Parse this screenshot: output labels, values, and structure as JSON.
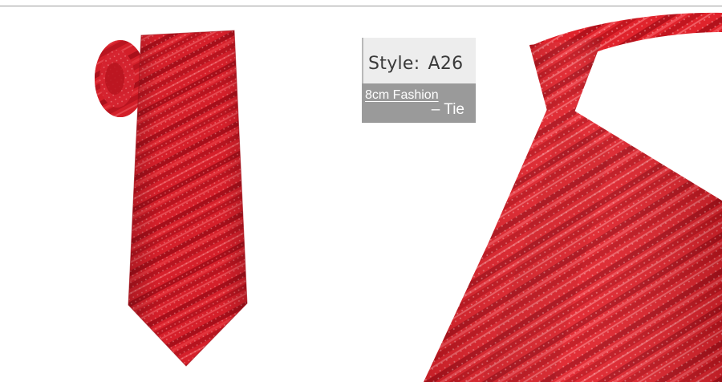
{
  "label": {
    "style_key": "Style:",
    "style_value": "A26",
    "desc_line1": "8cm Fashion",
    "desc_line2": "– Tie"
  },
  "colors": {
    "tie_base": "#d51f2a",
    "tie_dark_stripe": "#a80f1a",
    "tie_light_stripe": "#e94048",
    "label_light": "#ededed",
    "label_dark": "#9a9a9a"
  },
  "images": {
    "left_product": "rolled-red-tie",
    "right_product": "knotted-red-tie"
  }
}
